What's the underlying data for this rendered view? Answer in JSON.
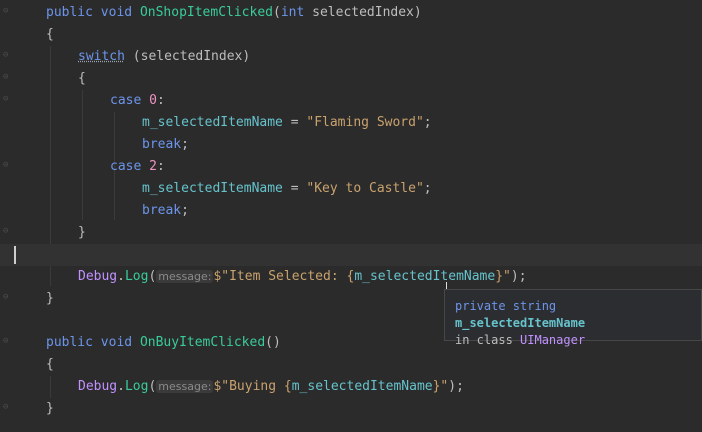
{
  "code": {
    "l1": {
      "mod": "public",
      "ret": "void",
      "name": "OnShopItemClicked",
      "p1": "(",
      "ptype": "int",
      "pname": " selectedIndex)"
    },
    "l2": "{",
    "l3": {
      "kw": "switch",
      "rest": " (selectedIndex)"
    },
    "l4": "{",
    "l5": {
      "kw": "case",
      "num": "0",
      "colon": ":"
    },
    "l6": {
      "field": "m_selectedItemName",
      "eq": " = ",
      "str": "\"Flaming Sword\"",
      "semi": ";"
    },
    "l7": {
      "kw": "break",
      "semi": ";"
    },
    "l8": {
      "kw": "case",
      "num": "2",
      "colon": ":"
    },
    "l9": {
      "field": "m_selectedItemName",
      "eq": " = ",
      "str": "\"Key to Castle\"",
      "semi": ";"
    },
    "l10": {
      "kw": "break",
      "semi": ";"
    },
    "l11": "}",
    "l13": {
      "cls": "Debug",
      "dot": ".",
      "method": "Log",
      "open": "(",
      "hint": "message:",
      "pre": "$\"Item Selected: {",
      "field": "m_selectedItemName",
      "post": "}\"",
      "close": ");"
    },
    "l14": "}",
    "l16": {
      "mod": "public",
      "ret": "void",
      "name": "OnBuyItemClicked",
      "rest": "()"
    },
    "l17": "{",
    "l18": {
      "cls": "Debug",
      "dot": ".",
      "method": "Log",
      "open": "(",
      "hint": "message:",
      "pre": "$\"Buying {",
      "field": "m_selectedItemName",
      "post": "}\"",
      "close": ");"
    },
    "l19": "}"
  },
  "tooltip": {
    "mods": "private string",
    "member": "m_selectedItemName",
    "in": "in class",
    "cls": "UIManager"
  },
  "colors": {
    "background": "#2b2b2b",
    "keyword": "#6c95eb",
    "method": "#39cc9b",
    "type": "#c191ff",
    "string": "#c9a26d",
    "field": "#66c3cc"
  }
}
